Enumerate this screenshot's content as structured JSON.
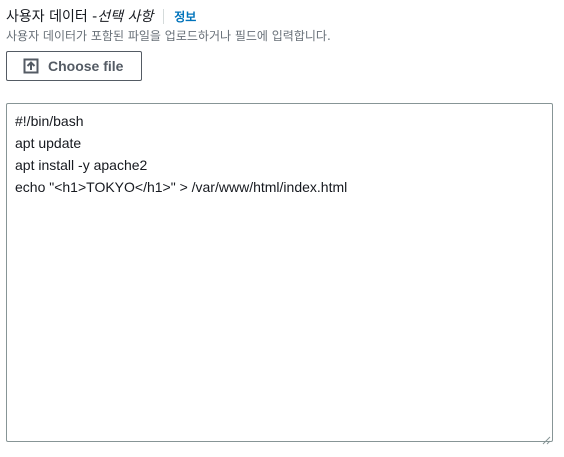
{
  "field": {
    "label": "사용자 데이터 - ",
    "optional": "선택 사항",
    "info_link": "정보",
    "description": "사용자 데이터가 포함된 파일을 업로드하거나 필드에 입력합니다."
  },
  "upload_button": {
    "label": "Choose file",
    "icon": "upload-icon"
  },
  "user_data": {
    "lines": [
      "#!/bin/bash",
      "apt update",
      "apt install -y apache2",
      "echo \"<h1>TOKYO</h1>\" > /var/www/html/index.html"
    ]
  },
  "colors": {
    "link": "#0073bb",
    "text": "#16191f",
    "secondary_text": "#687078",
    "border": "#879596"
  }
}
